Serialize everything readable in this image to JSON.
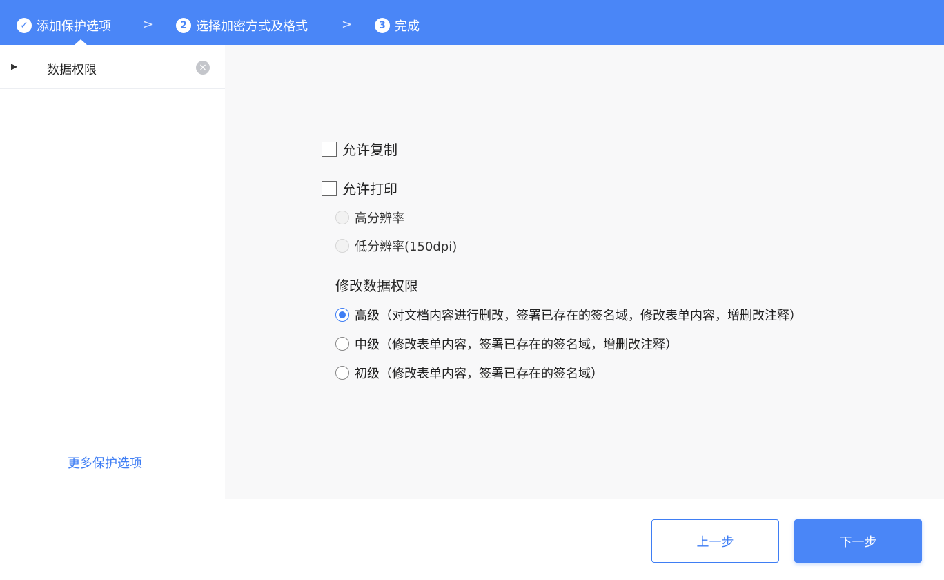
{
  "steps": [
    {
      "icon": "✓",
      "label": "添加保护选项"
    },
    {
      "icon": "2",
      "label": "选择加密方式及格式"
    },
    {
      "icon": "3",
      "label": "完成"
    }
  ],
  "separator": ">",
  "sidebar": {
    "item_label": "数据权限",
    "more_link": "更多保护选项"
  },
  "options": {
    "allow_copy": {
      "label": "允许复制",
      "checked": false
    },
    "allow_print": {
      "label": "允许打印",
      "checked": false
    },
    "print_high": {
      "label": "高分辨率",
      "disabled": true
    },
    "print_low": {
      "label": "低分辨率(150dpi)",
      "disabled": true
    }
  },
  "modify": {
    "title": "修改数据权限",
    "levels": [
      {
        "label": "高级（对文档内容进行删改，签署已存在的签名域，修改表单内容，增删改注释）",
        "checked": true
      },
      {
        "label": "中级（修改表单内容，签署已存在的签名域，增删改注释）",
        "checked": false
      },
      {
        "label": "初级（修改表单内容，签署已存在的签名域）",
        "checked": false
      }
    ]
  },
  "buttons": {
    "prev": "上一步",
    "next": "下一步"
  },
  "colors": {
    "primary": "#4a86f7",
    "link": "#3f7ef4",
    "content_bg": "#f8f8f9"
  }
}
